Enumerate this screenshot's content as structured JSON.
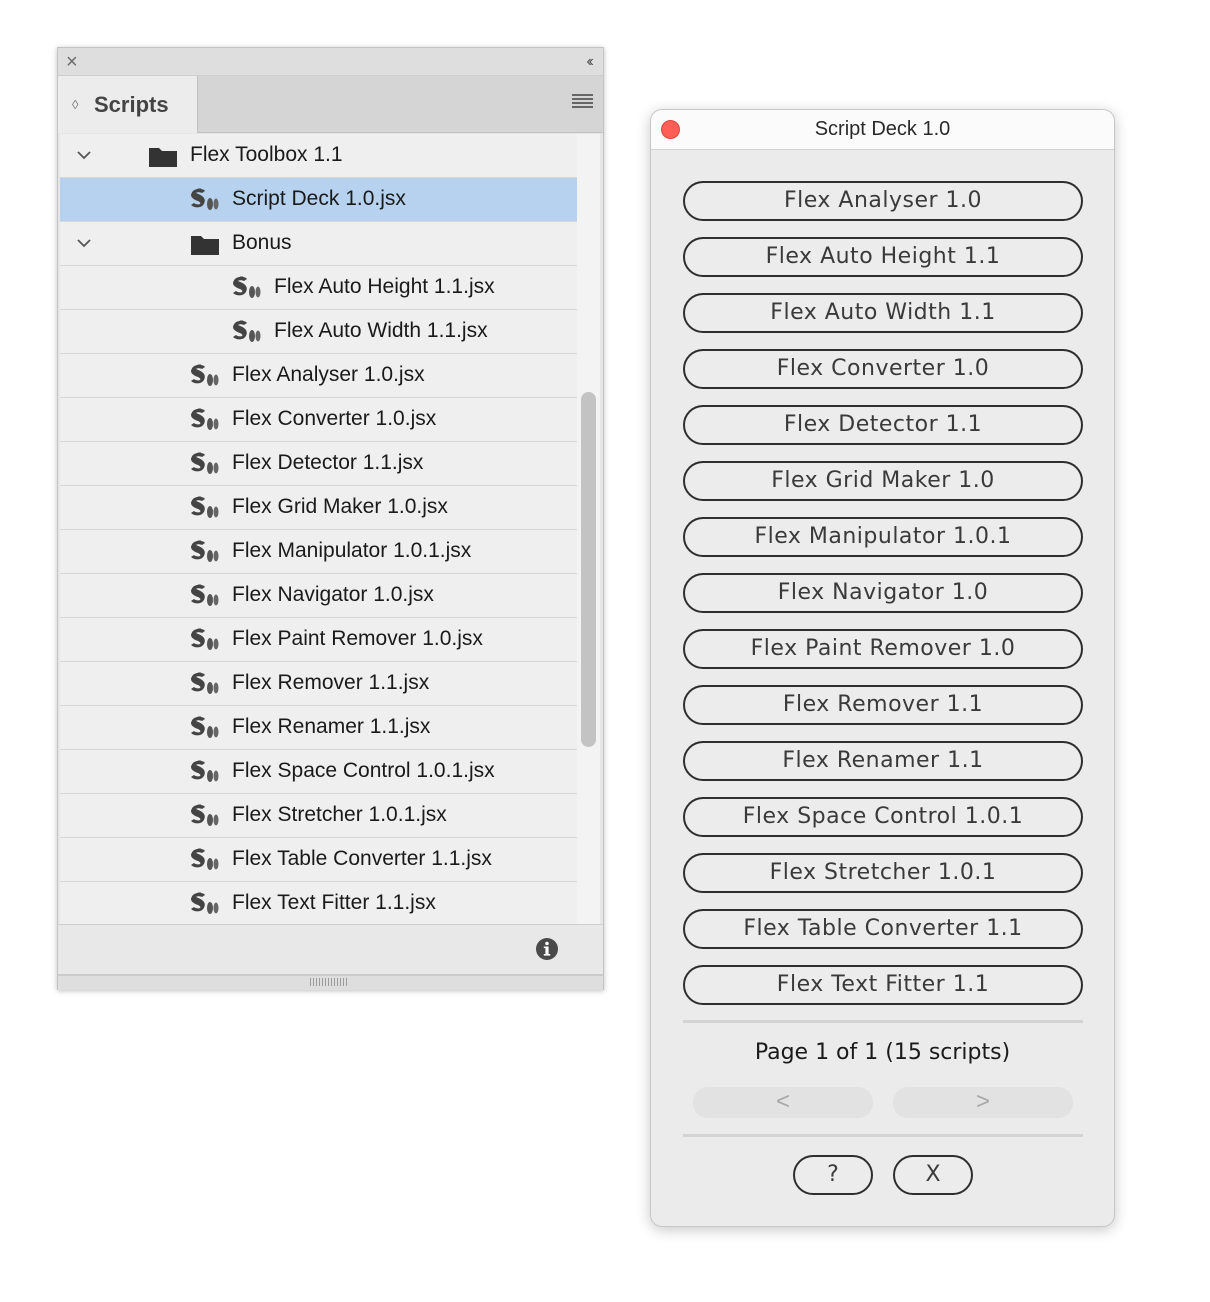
{
  "panel": {
    "tab_label": "Scripts",
    "tree": [
      {
        "label": "Flex Toolbox 1.1",
        "kind": "folder",
        "depth": 0,
        "expanded": true,
        "selected": false
      },
      {
        "label": "Script Deck 1.0.jsx",
        "kind": "script",
        "depth": 1,
        "selected": true
      },
      {
        "label": "Bonus",
        "kind": "folder",
        "depth": 1,
        "expanded": true,
        "selected": false
      },
      {
        "label": "Flex Auto Height 1.1.jsx",
        "kind": "script",
        "depth": 2,
        "selected": false
      },
      {
        "label": "Flex Auto Width 1.1.jsx",
        "kind": "script",
        "depth": 2,
        "selected": false
      },
      {
        "label": "Flex Analyser 1.0.jsx",
        "kind": "script",
        "depth": 1,
        "selected": false
      },
      {
        "label": "Flex Converter 1.0.jsx",
        "kind": "script",
        "depth": 1,
        "selected": false
      },
      {
        "label": "Flex Detector 1.1.jsx",
        "kind": "script",
        "depth": 1,
        "selected": false
      },
      {
        "label": "Flex Grid Maker 1.0.jsx",
        "kind": "script",
        "depth": 1,
        "selected": false
      },
      {
        "label": "Flex Manipulator 1.0.1.jsx",
        "kind": "script",
        "depth": 1,
        "selected": false
      },
      {
        "label": "Flex Navigator 1.0.jsx",
        "kind": "script",
        "depth": 1,
        "selected": false
      },
      {
        "label": "Flex Paint Remover 1.0.jsx",
        "kind": "script",
        "depth": 1,
        "selected": false
      },
      {
        "label": "Flex Remover 1.1.jsx",
        "kind": "script",
        "depth": 1,
        "selected": false
      },
      {
        "label": "Flex Renamer 1.1.jsx",
        "kind": "script",
        "depth": 1,
        "selected": false
      },
      {
        "label": "Flex Space Control 1.0.1.jsx",
        "kind": "script",
        "depth": 1,
        "selected": false
      },
      {
        "label": "Flex Stretcher 1.0.1.jsx",
        "kind": "script",
        "depth": 1,
        "selected": false
      },
      {
        "label": "Flex Table Converter 1.1.jsx",
        "kind": "script",
        "depth": 1,
        "selected": false
      },
      {
        "label": "Flex Text Fitter 1.1.jsx",
        "kind": "script",
        "depth": 1,
        "selected": false
      }
    ],
    "icons": {
      "close": "close-icon",
      "collapse": "collapse-double-chevron-icon",
      "menu": "hamburger-menu-icon",
      "info": "info-icon",
      "folder": "folder-icon",
      "script": "script-icon",
      "expanded": "chevron-down-icon"
    },
    "selection_color": "#b7d2ee"
  },
  "dialog": {
    "title": "Script Deck 1.0",
    "close_color": "#ff5f57",
    "buttons": [
      "Flex Analyser 1.0",
      "Flex Auto Height 1.1",
      "Flex Auto Width 1.1",
      "Flex Converter 1.0",
      "Flex Detector 1.1",
      "Flex Grid Maker 1.0",
      "Flex Manipulator 1.0.1",
      "Flex Navigator 1.0",
      "Flex Paint Remover 1.0",
      "Flex Remover 1.1",
      "Flex Renamer 1.1",
      "Flex Space Control 1.0.1",
      "Flex Stretcher 1.0.1",
      "Flex Table Converter 1.1",
      "Flex Text Fitter 1.1"
    ],
    "page_info": "Page 1 of 1 (15 scripts)",
    "prev_label": "<",
    "next_label": ">",
    "help_label": "?",
    "close_label": "X"
  }
}
